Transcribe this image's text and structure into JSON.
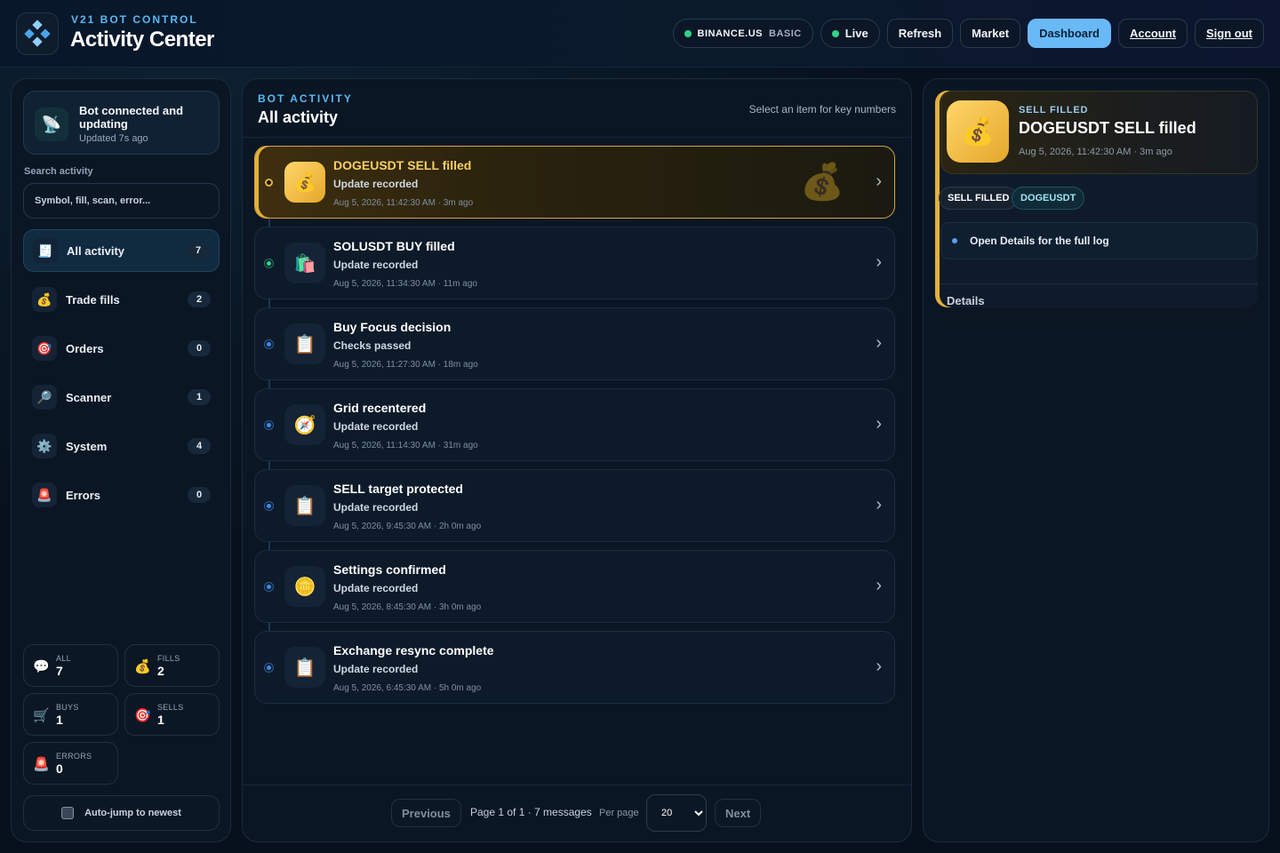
{
  "header": {
    "kicker": "V21 BOT CONTROL",
    "title": "Activity Center",
    "exchange": "BINANCE.US",
    "exchange_tier": "BASIC",
    "live": "Live",
    "refresh": "Refresh",
    "market": "Market",
    "dashboard": "Dashboard",
    "account": "Account",
    "signout": "Sign out",
    "accent": "#5ab8f2",
    "active_color": "#69b9f6"
  },
  "status": {
    "title": "Bot connected and updating",
    "updated": "Updated 7s ago",
    "icon": "satellite-icon"
  },
  "search": {
    "label": "Search activity",
    "placeholder": "Symbol, fill, scan, error..."
  },
  "filters": [
    {
      "label": "All activity",
      "count": "7",
      "icon": "receipt-icon",
      "glyph": "🧾"
    },
    {
      "label": "Trade fills",
      "count": "2",
      "icon": "money-bag-icon",
      "glyph": "💰"
    },
    {
      "label": "Orders",
      "count": "0",
      "icon": "target-icon",
      "glyph": "🎯"
    },
    {
      "label": "Scanner",
      "count": "1",
      "icon": "magnifier-icon",
      "glyph": "🔎"
    },
    {
      "label": "System",
      "count": "4",
      "icon": "gear-icon",
      "glyph": "⚙️"
    },
    {
      "label": "Errors",
      "count": "0",
      "icon": "siren-icon",
      "glyph": "🚨"
    }
  ],
  "stats": {
    "all": {
      "label": "ALL",
      "value": "7"
    },
    "fills": {
      "label": "FILLS",
      "value": "2"
    },
    "buys": {
      "label": "BUYS",
      "value": "1"
    },
    "sells": {
      "label": "SELLS",
      "value": "1"
    },
    "errors": {
      "label": "ERRORS",
      "value": "0"
    }
  },
  "autojump": "Auto-jump to newest",
  "feed": {
    "kicker": "BOT ACTIVITY",
    "title": "All activity",
    "hint": "Select an item for key numbers",
    "items": [
      {
        "title": "DOGEUSDT SELL filled",
        "sub": "Update recorded",
        "time": "Aug 5, 2026, 11:42:30 AM · 3m ago",
        "icon": "money-bag-icon"
      },
      {
        "title": "SOLUSDT BUY filled",
        "sub": "Update recorded",
        "time": "Aug 5, 2026, 11:34:30 AM · 11m ago",
        "icon": "shopping-bags-icon"
      },
      {
        "title": "Buy Focus decision",
        "sub": "Checks passed",
        "time": "Aug 5, 2026, 11:27:30 AM · 18m ago",
        "icon": "clipboard-icon"
      },
      {
        "title": "Grid recentered",
        "sub": "Update recorded",
        "time": "Aug 5, 2026, 11:14:30 AM · 31m ago",
        "icon": "compass-icon"
      },
      {
        "title": "SELL target protected",
        "sub": "Update recorded",
        "time": "Aug 5, 2026, 9:45:30 AM · 2h 0m ago",
        "icon": "clipboard-icon"
      },
      {
        "title": "Settings confirmed",
        "sub": "Update recorded",
        "time": "Aug 5, 2026, 8:45:30 AM · 3h 0m ago",
        "icon": "coin-icon"
      },
      {
        "title": "Exchange resync complete",
        "sub": "Update recorded",
        "time": "Aug 5, 2026, 6:45:30 AM · 5h 0m ago",
        "icon": "clipboard-icon"
      }
    ]
  },
  "pager": {
    "previous": "Previous",
    "info": "Page 1 of 1 · 7 messages",
    "per_page": "Per page",
    "per_page_value": "20",
    "next": "Next"
  },
  "detail": {
    "kicker": "SELL FILLED",
    "title": "DOGEUSDT SELL filled",
    "time": "Aug 5, 2026, 11:42:30 AM · 3m ago",
    "tag1": "SELL FILLED",
    "tag2": "DOGEUSDT",
    "row": "Open Details for the full log",
    "details": "Details",
    "accent": "#e3b13b"
  }
}
